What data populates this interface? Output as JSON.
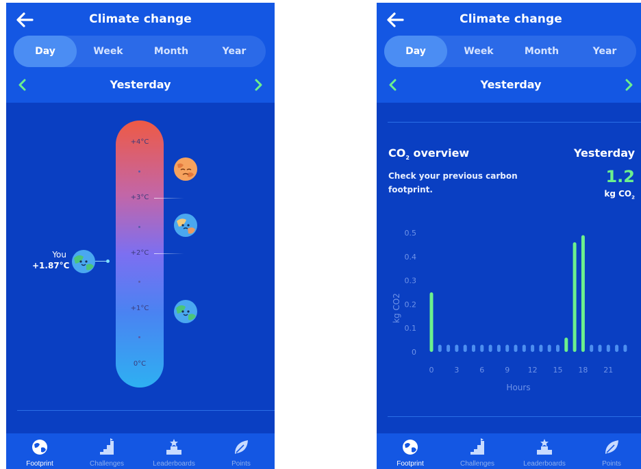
{
  "header": {
    "title": "Climate change",
    "tabs": [
      "Day",
      "Week",
      "Month",
      "Year"
    ],
    "active_tab": "Day",
    "date_label": "Yesterday"
  },
  "thermometer": {
    "ticks": [
      "+4°C",
      "+3°C",
      "+2°C",
      "+1°C",
      "0°C"
    ],
    "you_label": "You",
    "you_value": "+1.87°C",
    "you_temperature_c": 1.87,
    "planet_icons": [
      "hot-earth-icon",
      "warming-earth-icon",
      "user-earth-icon",
      "healthy-earth-icon"
    ]
  },
  "co2": {
    "title_main": "CO",
    "title_sub": "2",
    "title_rest": " overview",
    "description": "Check your previous carbon footprint.",
    "date_label": "Yesterday",
    "value": "1.2",
    "unit_main": "kg CO",
    "unit_sub": "2"
  },
  "tabbar": {
    "items": [
      {
        "label": "Footprint",
        "icon": "globe-icon",
        "active": true
      },
      {
        "label": "Challenges",
        "icon": "challenges-stairs-icon",
        "active": false
      },
      {
        "label": "Leaderboards",
        "icon": "podium-star-icon",
        "active": false
      },
      {
        "label": "Points",
        "icon": "leaf-icon",
        "active": false
      }
    ]
  },
  "colors": {
    "background": "#0a3fc2",
    "header": "#1457e3",
    "accent_green": "#6cf08d",
    "bar_normal": "#4d8ff0"
  },
  "chart_data": {
    "type": "bar",
    "xlabel": "Hours",
    "ylabel": "kg CO2",
    "ylim": [
      0,
      0.5
    ],
    "yticks": [
      0,
      0.1,
      0.2,
      0.3,
      0.4,
      0.5
    ],
    "xticks": [
      0,
      3,
      6,
      9,
      12,
      15,
      18,
      21
    ],
    "x": [
      0,
      1,
      2,
      3,
      4,
      5,
      6,
      7,
      8,
      9,
      10,
      11,
      12,
      13,
      14,
      15,
      16,
      17,
      18,
      19,
      20,
      21,
      22,
      23
    ],
    "values": [
      0.25,
      0.03,
      0.03,
      0.03,
      0.03,
      0.03,
      0.03,
      0.03,
      0.03,
      0.03,
      0.03,
      0.03,
      0.03,
      0.03,
      0.03,
      0.03,
      0.06,
      0.46,
      0.49,
      0.03,
      0.03,
      0.03,
      0.03,
      0.03
    ],
    "highlighted": [
      0,
      16,
      17,
      18
    ],
    "grid": false
  }
}
